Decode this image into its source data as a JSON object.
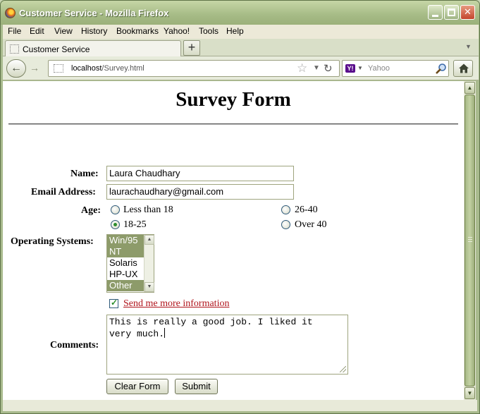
{
  "window": {
    "title": "Customer Service - Mozilla Firefox"
  },
  "menu": [
    "File",
    "Edit",
    "View",
    "History",
    "Bookmarks",
    "Yahoo!",
    "Tools",
    "Help"
  ],
  "tab": {
    "label": "Customer Service",
    "new_tab_label": "+"
  },
  "navbar": {
    "url_host": "localhost",
    "url_path": "/Survey.html",
    "search_placeholder": "Yahoo",
    "search_engine_logo": "Y!"
  },
  "form": {
    "title": "Survey Form",
    "name_label": "Name:",
    "name_value": "Laura Chaudhary",
    "email_label": "Email Address:",
    "email_value": "laurachaudhary@gmail.com",
    "age_label": "Age:",
    "age_options": [
      {
        "label": "Less than 18",
        "checked": false
      },
      {
        "label": "26-40",
        "checked": false
      },
      {
        "label": "18-25",
        "checked": true
      },
      {
        "label": "Over 40",
        "checked": false
      }
    ],
    "os_label": "Operating Systems:",
    "os_options": [
      {
        "label": "Win/95",
        "selected": true
      },
      {
        "label": "NT",
        "selected": true
      },
      {
        "label": "Solaris",
        "selected": false
      },
      {
        "label": "HP-UX",
        "selected": false
      },
      {
        "label": "Other",
        "selected": true
      }
    ],
    "more_info_label": "Send me more information",
    "more_info_checked": true,
    "comments_label": "Comments:",
    "comments_value": "This is really a good job. I liked it\nvery much.",
    "clear_label": "Clear Form",
    "submit_label": "Submit"
  },
  "icons": {
    "app": "firefox-icon",
    "back": "back-arrow-icon",
    "forward": "forward-arrow-icon",
    "bookmark": "star-icon",
    "reload": "reload-icon",
    "search": "magnifier-icon",
    "home": "home-icon"
  },
  "colors": {
    "link": "#b0141c",
    "selection": "#8d9b6a",
    "chrome": "#a9bb8e"
  }
}
